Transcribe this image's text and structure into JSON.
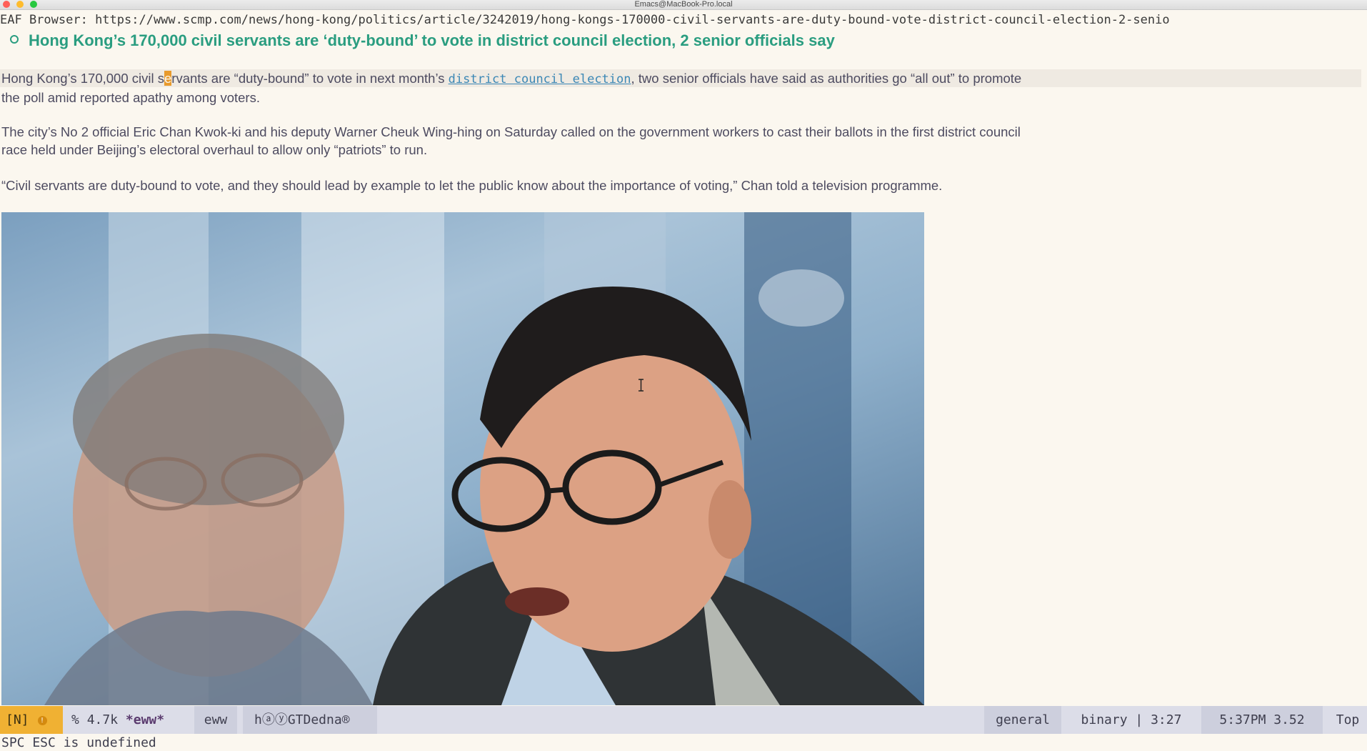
{
  "window": {
    "title": "Emacs@MacBook-Pro.local"
  },
  "header": {
    "prefix": "EAF Browser: ",
    "url": "https://www.scmp.com/news/hong-kong/politics/article/3242019/hong-kongs-170000-civil-servants-are-duty-bound-vote-district-council-election-2-senio"
  },
  "article": {
    "heading": "Hong Kong’s 170,000 civil servants are ‘duty-bound’ to vote in district council election, 2 senior officials say",
    "p1_before_cursor": "Hong Kong’s 170,000 civil s",
    "p1_cursor_char": "e",
    "p1_after_cursor": "rvants are “duty-bound” to vote in next month’s ",
    "p1_link": "district council election",
    "p1_after_link": ", two senior officials have said as authorities go “all out” to promote the poll amid reported apathy among voters.",
    "p2": "The city’s No 2 official Eric Chan Kwok-ki and his deputy Warner Cheuk Wing-hing on Saturday called on the government workers to cast their ballots in the first district council race held under Beijing’s electoral overhaul to allow only “patriots” to run.",
    "p3": "“Civil servants are duty-bound to vote, and they should lead by example to let the public know about the importance of voting,” Chan told a television programme."
  },
  "modeline": {
    "state": "[N]",
    "state_icon": "!",
    "percent": "%",
    "size": "4.7k",
    "buffer": "*eww*",
    "mode": "eww",
    "misc": "hⓐⓨGTDedna®",
    "general": "general",
    "binary": "binary | 3:27",
    "time": "5:37PM 3.52",
    "position": "Top"
  },
  "echo": {
    "message": "SPC ESC is undefined"
  },
  "colors": {
    "background": "#fbf7ef",
    "heading": "#2a9d80",
    "link": "#3b87b5",
    "cursor": "#e89a2c",
    "modeline": "#dcdde8",
    "state": "#f0b133"
  }
}
